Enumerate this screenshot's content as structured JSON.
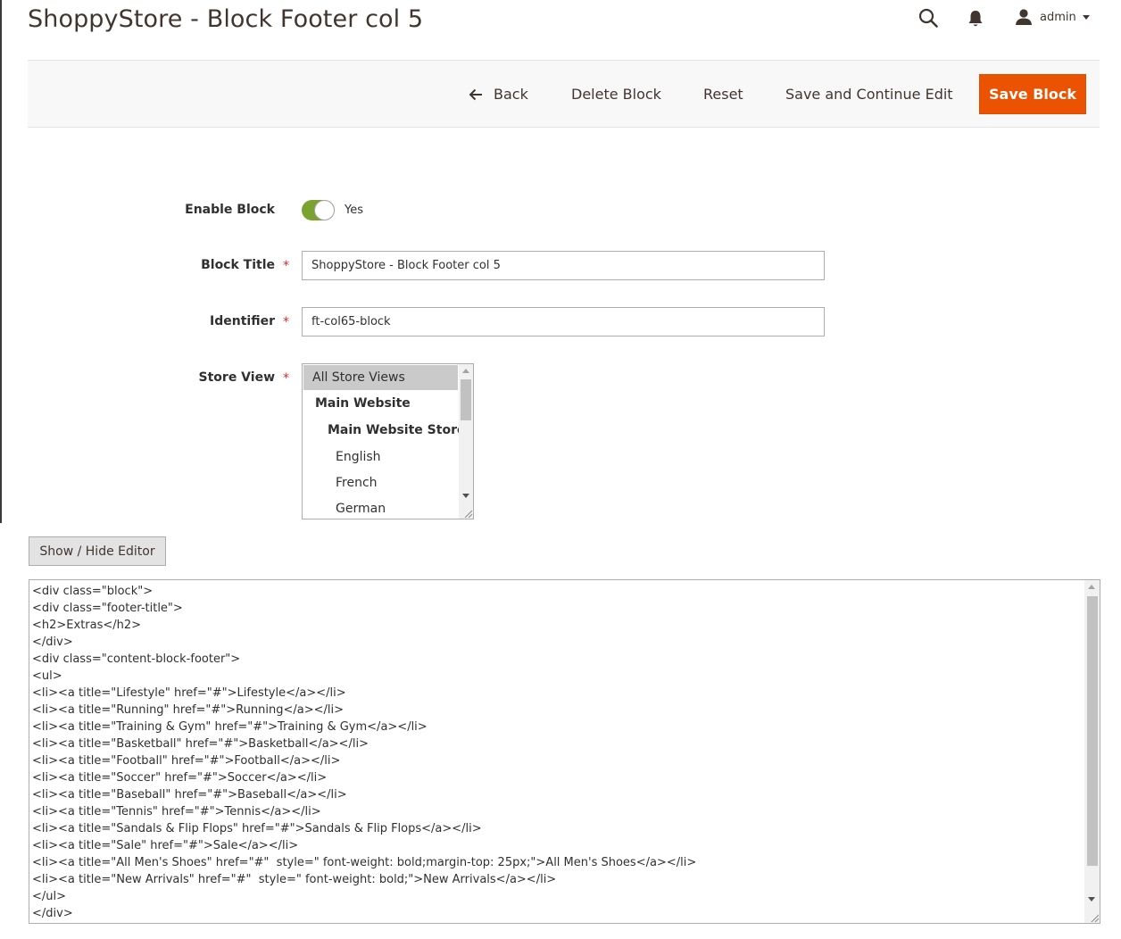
{
  "header": {
    "title": "ShoppyStore - Block Footer col 5",
    "user_name": "admin",
    "icons": [
      "search-icon",
      "bell-icon",
      "user-icon",
      "chevron-down-icon"
    ]
  },
  "toolbar": {
    "back_label": "Back",
    "delete_label": "Delete Block",
    "reset_label": "Reset",
    "save_continue_label": "Save and Continue Edit",
    "save_label": "Save Block"
  },
  "form": {
    "enable": {
      "label": "Enable Block",
      "value_text": "Yes",
      "checked": true
    },
    "title": {
      "label": "Block Title",
      "value": "ShoppyStore - Block Footer col 5",
      "required": "*"
    },
    "identifier": {
      "label": "Identifier",
      "value": "ft-col65-block",
      "required": "*"
    },
    "store_view": {
      "label": "Store View",
      "required": "*",
      "options": [
        {
          "text": "All Store Views",
          "selected": true
        },
        {
          "text": "Main Website"
        },
        {
          "text": "Main Website Store"
        },
        {
          "text": "English"
        },
        {
          "text": "French"
        },
        {
          "text": "German"
        }
      ]
    }
  },
  "editor": {
    "toggle_label": "Show / Hide Editor",
    "lines": [
      "<div class=\"block\">",
      "<div class=\"footer-title\">",
      "<h2>Extras</h2>",
      "</div>",
      "<div class=\"content-block-footer\">",
      "<ul>",
      "<li><a title=\"Lifestyle\" href=\"#\">Lifestyle</a></li>",
      "<li><a title=\"Running\" href=\"#\">Running</a></li>",
      "<li><a title=\"Training & Gym\" href=\"#\">Training & Gym</a></li>",
      "<li><a title=\"Basketball\" href=\"#\">Basketball</a></li>",
      "<li><a title=\"Football\" href=\"#\">Football</a></li>",
      "<li><a title=\"Soccer\" href=\"#\">Soccer</a></li>",
      "<li><a title=\"Baseball\" href=\"#\">Baseball</a></li>",
      "<li><a title=\"Tennis\" href=\"#\">Tennis</a></li>",
      "<li><a title=\"Sandals & Flip Flops\" href=\"#\">Sandals & Flip Flops</a></li>",
      "<li><a title=\"Sale\" href=\"#\">Sale</a></li>",
      "<li><a title=\"All Men's Shoes\" href=\"#\"  style=\" font-weight: bold;margin-top: 25px;\">All Men's Shoes</a></li>",
      "<li><a title=\"New Arrivals\" href=\"#\"  style=\" font-weight: bold;\">New Arrivals</a></li>",
      "</ul>",
      "</div>"
    ]
  },
  "colors": {
    "accent": "#eb5202",
    "toggle_on": "#79a22e",
    "required": "#e22626",
    "text": "#303030",
    "heading": "#41362f"
  }
}
